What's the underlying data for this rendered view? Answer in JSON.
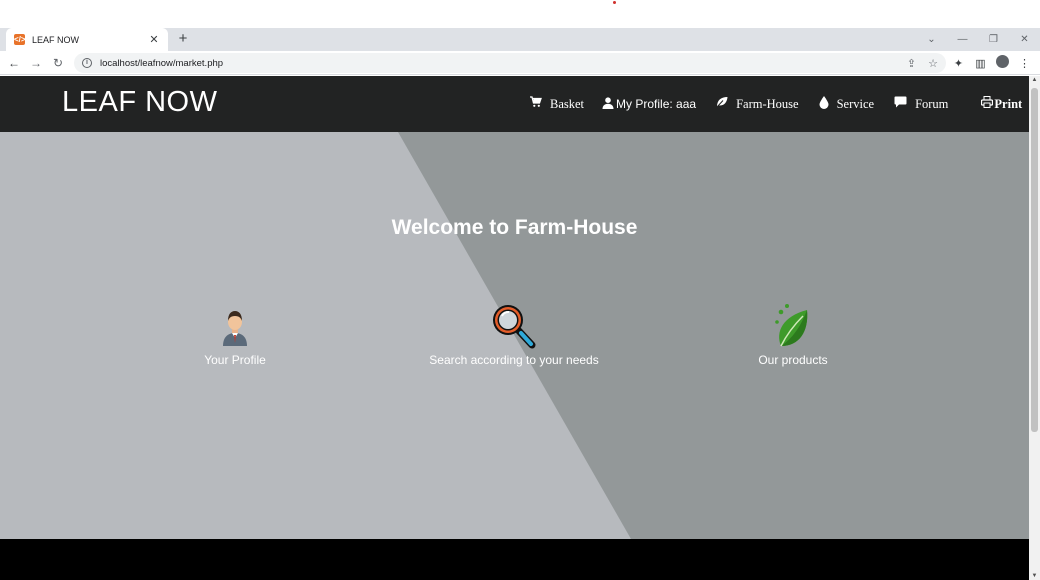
{
  "browser": {
    "tab_title": "LEAF NOW",
    "tab_favicon": "html-file-icon",
    "new_tab": "+",
    "url": "localhost/leafnow/market.php",
    "window_controls": [
      "chevron-down-icon",
      "minimize-icon",
      "restore-icon",
      "close-icon"
    ]
  },
  "navbar": {
    "brand": "LEAF NOW",
    "links": [
      {
        "icon": "cart-icon",
        "label": "Basket"
      },
      {
        "icon": "user-icon",
        "label": "My Profile: aaa"
      },
      {
        "icon": "leaf-icon",
        "label": "Farm-House"
      },
      {
        "icon": "drop-icon",
        "label": "Service"
      },
      {
        "icon": "comment-icon",
        "label": "Forum"
      },
      {
        "icon": "print-icon",
        "label": "Print"
      }
    ]
  },
  "hero": {
    "title": "Welcome to Farm-House",
    "features": [
      {
        "icon": "businessman-icon",
        "label": "Your Profile"
      },
      {
        "icon": "magnifier-icon",
        "label": "Search according to your needs"
      },
      {
        "icon": "green-leaf-icon",
        "label": "Our products"
      }
    ]
  },
  "colors": {
    "navbar_bg": "#222323",
    "hero_light": "#b7babe",
    "hero_dark": "#939899",
    "footer_bg": "#000000"
  }
}
